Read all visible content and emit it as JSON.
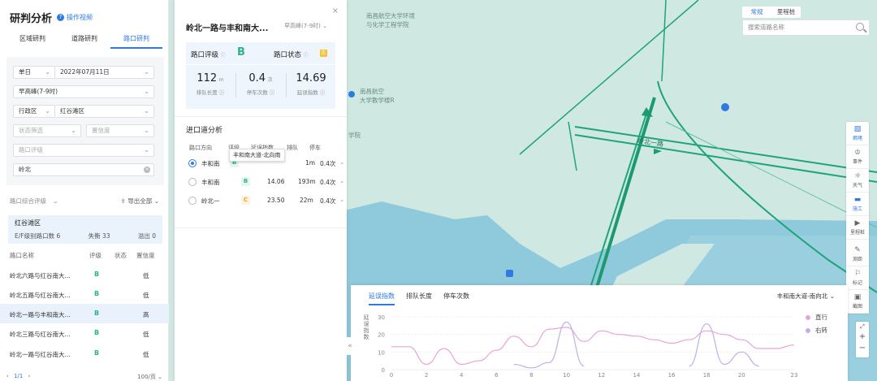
{
  "left_panel": {
    "title": "研判分析",
    "help_link": "操作视频",
    "tabs": [
      {
        "label": "区域研判",
        "active": false
      },
      {
        "label": "道路研判",
        "active": false
      },
      {
        "label": "路口研判",
        "active": true
      }
    ],
    "filters": {
      "date_mode": "单日",
      "date": "2022年07月11日",
      "period": "早高峰(7-9时)",
      "admin_type": "行政区",
      "district": "红谷滩区",
      "status_placeholder": "状态筛选",
      "credibility_placeholder": "置信度",
      "grade_placeholder": "路口评级",
      "keyword": "岭北"
    },
    "rating_filter": "路口综合评级",
    "export_label": "导出全部",
    "district_summary": {
      "name": "红谷滩区",
      "ef_label": "E/F级别路口数 6",
      "imbalance": "失衡 33",
      "overflow": "溢出 0"
    },
    "table": {
      "headers": [
        "路口名称",
        "评级",
        "状态",
        "置信度"
      ],
      "rows": [
        {
          "name": "岭北六路与红谷南大...",
          "grade": "B",
          "status": "",
          "credibility": "低",
          "selected": false
        },
        {
          "name": "岭北五路与红谷南大...",
          "grade": "B",
          "status": "",
          "credibility": "低",
          "selected": false
        },
        {
          "name": "岭北一路与丰和南大...",
          "grade": "B",
          "status": "",
          "credibility": "高",
          "selected": true
        },
        {
          "name": "岭北三路与红谷南大...",
          "grade": "B",
          "status": "",
          "credibility": "低",
          "selected": false
        },
        {
          "name": "岭北一路与红谷南大...",
          "grade": "B",
          "status": "",
          "credibility": "低",
          "selected": false
        }
      ]
    },
    "pager": {
      "current": "1/1",
      "page_size": "100/页"
    }
  },
  "detail": {
    "title": "岭北一路与丰和南大...",
    "period": "早高峰(7-9时)",
    "grade_label": "路口评级",
    "grade": "B",
    "status_label": "路口状态",
    "status_icon": "正",
    "metrics": [
      {
        "value": "112",
        "unit": "m",
        "label": "排队长度"
      },
      {
        "value": "0.4",
        "unit": "次",
        "label": "停车次数"
      },
      {
        "value": "14.69",
        "unit": "",
        "label": "延误指数"
      }
    ],
    "approach_title": "进口道分析",
    "approach_headers": [
      "路口方向",
      "评级",
      "延误指数",
      "排队",
      "停车"
    ],
    "tooltip": "丰和南大道-北向南",
    "approaches": [
      {
        "dir": "丰和南",
        "grade": "B",
        "delay": "",
        "queue": "1m",
        "stops": "0.4次",
        "selected": true
      },
      {
        "dir": "丰和南",
        "grade": "B",
        "delay": "14.06",
        "queue": "193m",
        "stops": "0.4次",
        "selected": false
      },
      {
        "dir": "岭北一",
        "grade": "C",
        "delay": "23.50",
        "queue": "22m",
        "stops": "0.4次",
        "selected": false
      }
    ]
  },
  "map": {
    "view_toggle": [
      {
        "label": "常规",
        "active": true
      },
      {
        "label": "里程桩",
        "active": false
      }
    ],
    "search_placeholder": "搜索道路名称",
    "labels": [
      {
        "text": "南昌航空大学环境"
      },
      {
        "text": "与化学工程学院"
      },
      {
        "text": "南昌航空"
      },
      {
        "text": "大学教学楼R"
      },
      {
        "text": "学院"
      },
      {
        "text": "岭北一路"
      }
    ],
    "tools": [
      {
        "label": "拥堵",
        "icon": "congestion-icon"
      },
      {
        "label": "事件",
        "icon": "event-icon"
      },
      {
        "label": "天气",
        "icon": "weather-icon"
      },
      {
        "label": "施工",
        "icon": "construction-icon"
      },
      {
        "label": "里程桩",
        "icon": "play-icon"
      },
      {
        "label": "测距",
        "icon": "ruler-icon"
      },
      {
        "label": "标记",
        "icon": "mark-icon"
      },
      {
        "label": "截图",
        "icon": "screenshot-icon"
      }
    ],
    "zoom_in": "+",
    "zoom_out": "−",
    "colors": {
      "road": "#1fa37a",
      "water": "#8ec9dc",
      "land": "#cfe8e2"
    }
  },
  "chart_panel": {
    "tabs": [
      {
        "label": "延误指数",
        "active": true
      },
      {
        "label": "排队长度",
        "active": false
      },
      {
        "label": "停车次数",
        "active": false
      }
    ],
    "direction": "丰和南大道-南向北",
    "ylabel": "延误指数"
  },
  "chart_data": {
    "type": "line",
    "x": [
      0,
      1,
      2,
      3,
      4,
      5,
      6,
      7,
      8,
      9,
      10,
      11,
      12,
      13,
      14,
      15,
      16,
      17,
      18,
      19,
      20,
      21,
      22,
      23
    ],
    "xticks": [
      0,
      2,
      4,
      6,
      8,
      10,
      12,
      14,
      16,
      18,
      20,
      23
    ],
    "yticks": [
      0,
      10,
      20,
      30
    ],
    "ylim": [
      0,
      30
    ],
    "xlim": [
      0,
      23
    ],
    "ylabel": "延误指数",
    "legend_position": "right",
    "series": [
      {
        "name": "直行",
        "color": "#e5a4d8",
        "values": [
          13,
          13,
          3,
          12,
          3,
          5,
          11,
          19,
          13,
          23,
          24,
          16,
          22,
          20,
          19,
          17,
          15,
          17,
          22,
          20,
          17,
          12,
          12,
          14
        ]
      },
      {
        "name": "右转",
        "color": "#c2aee6",
        "values": [
          null,
          null,
          null,
          null,
          null,
          null,
          null,
          3,
          1,
          4,
          27,
          2,
          null,
          null,
          3,
          null,
          null,
          2,
          26,
          3,
          10,
          2,
          null,
          null
        ]
      }
    ]
  }
}
